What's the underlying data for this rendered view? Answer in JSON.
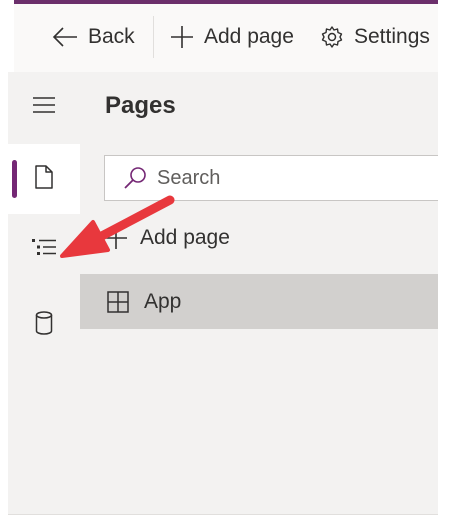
{
  "command_bar": {
    "back_label": "Back",
    "add_page_label": "Add page",
    "settings_label": "Settings"
  },
  "rail": {
    "items": [
      {
        "icon": "hamburger-menu-icon"
      },
      {
        "icon": "page-icon",
        "active": true
      },
      {
        "icon": "tree-view-icon"
      },
      {
        "icon": "data-cylinder-icon"
      }
    ]
  },
  "pages_pane": {
    "title": "Pages",
    "search_placeholder": "Search",
    "add_page_label": "Add page",
    "pages": [
      {
        "label": "App",
        "icon": "app-layout-icon",
        "selected": true
      }
    ]
  },
  "colors": {
    "accent": "#742774",
    "arrow": "#e8383d",
    "selected_row": "#d2d0ce"
  }
}
